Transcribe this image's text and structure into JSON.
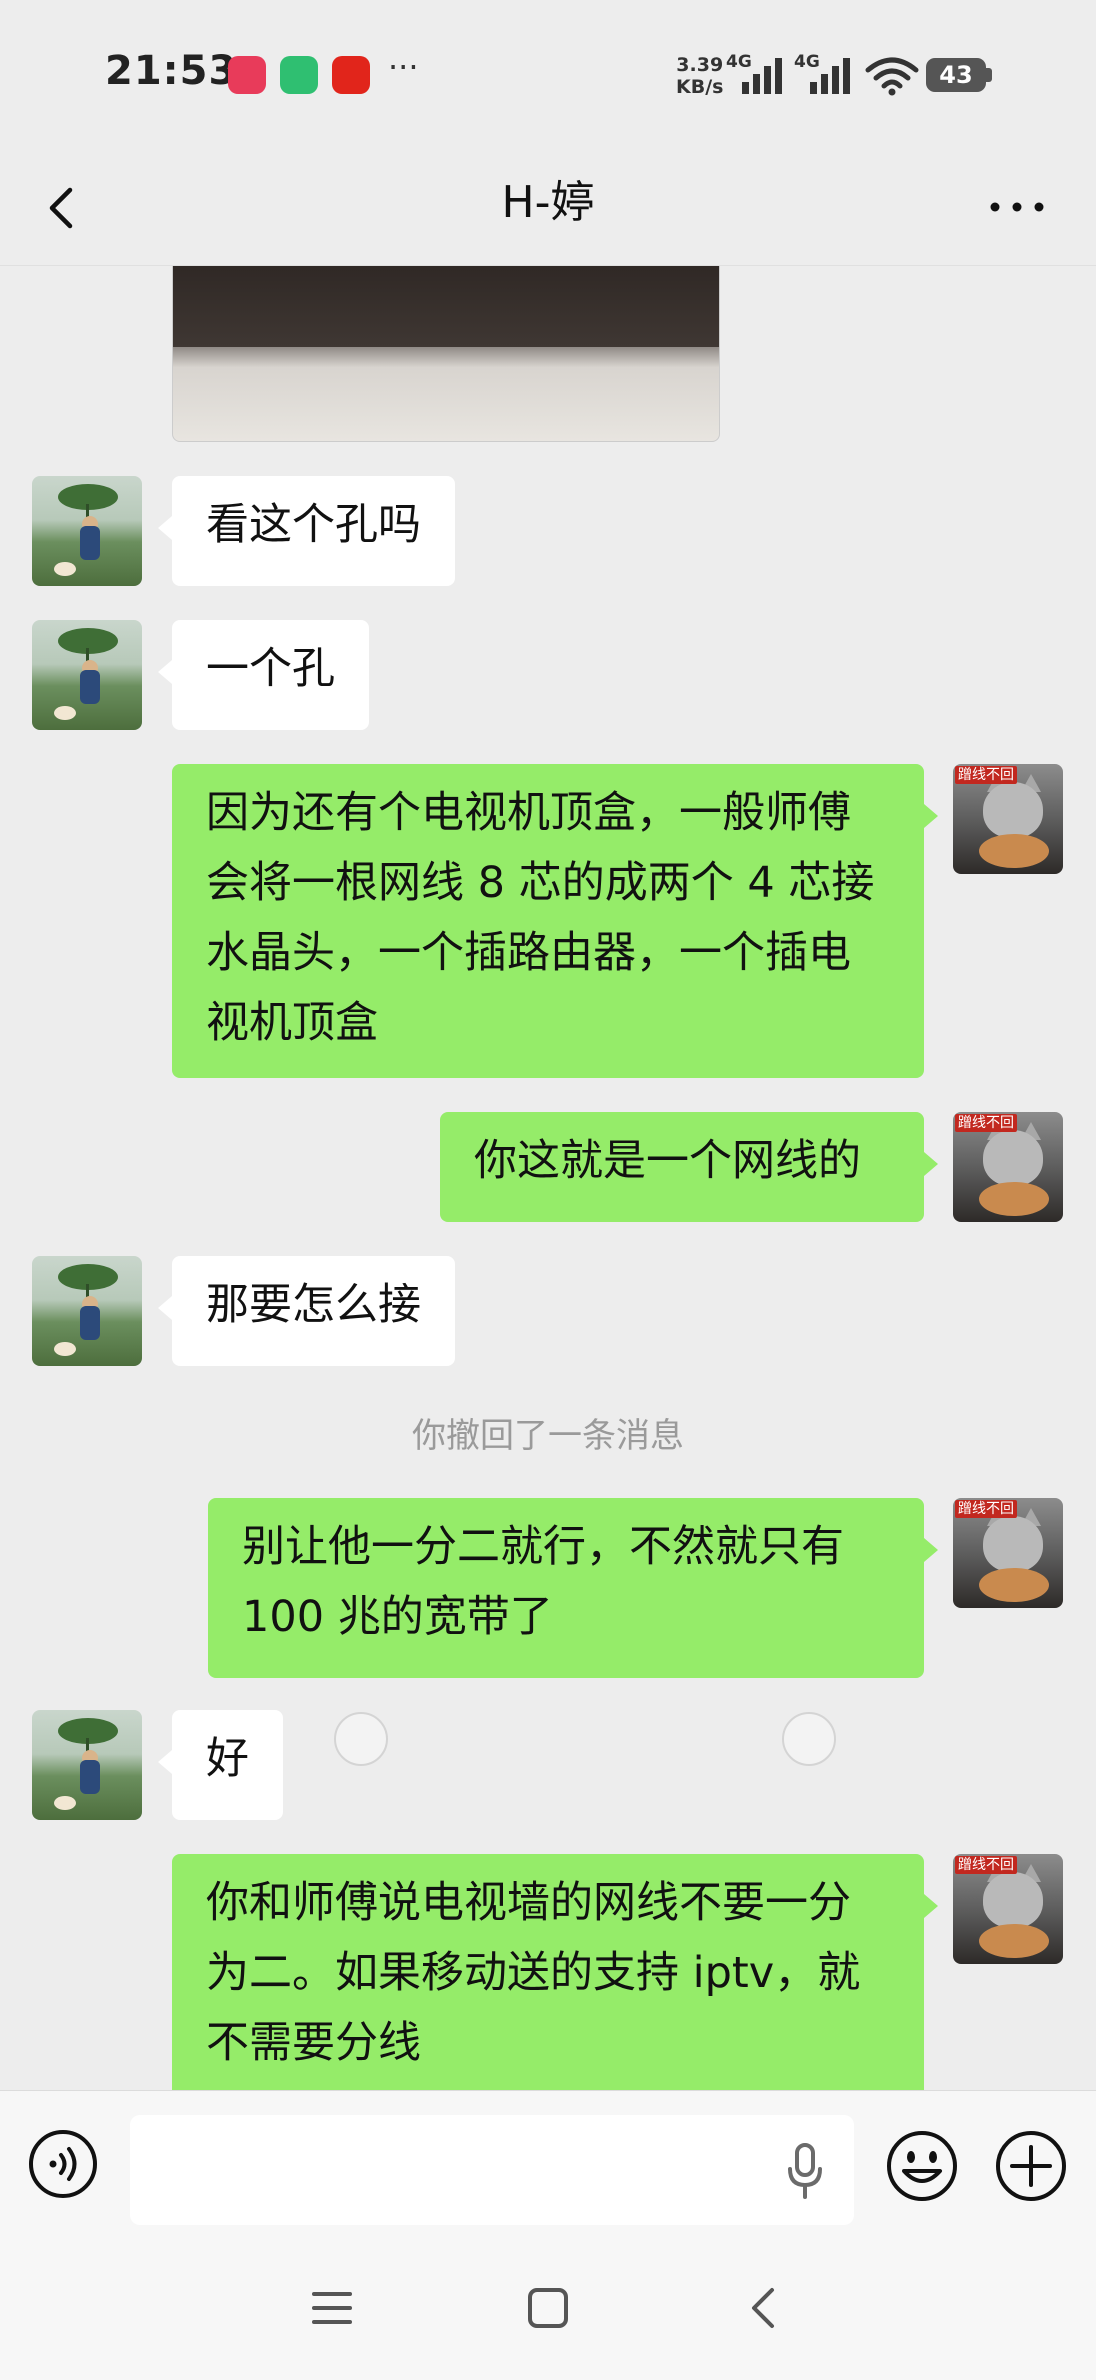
{
  "status_bar": {
    "time": "21:53",
    "apps": [
      {
        "icon": "shopping-618-app-icon",
        "color": "#e83b5a"
      },
      {
        "icon": "mijia-app-icon",
        "color": "#2fbf71"
      },
      {
        "icon": "tmall-app-icon",
        "color": "#e1251b"
      }
    ],
    "more": "···",
    "net_speed_value": "3.39",
    "net_speed_unit": "KB/s",
    "signal1_label": "4G",
    "signal2_label": "4G",
    "battery": "43"
  },
  "header": {
    "title": "H-婷"
  },
  "messages": [
    {
      "side": "in",
      "text": "看这个孔吗"
    },
    {
      "side": "in",
      "text": "一个孔"
    },
    {
      "side": "out",
      "text": "因为还有个电视机顶盒，一般师傅会将一根网线 8 芯的成两个 4 芯接水晶头，一个插路由器，一个插电视机顶盒"
    },
    {
      "side": "out",
      "text": "你这就是一个网线的"
    },
    {
      "side": "in",
      "text": "那要怎么接"
    },
    {
      "side": "system",
      "text": "你撤回了一条消息"
    },
    {
      "side": "out",
      "text": "别让他一分二就行，不然就只有100 兆的宽带了"
    },
    {
      "side": "in",
      "text": "好"
    },
    {
      "side": "out",
      "text": "你和师傅说电视墙的网线不要一分为二。如果移动送的支持 iptv，就不需要分线"
    }
  ],
  "avatar_right_tag": "蹭线不回",
  "input_bar": {
    "placeholder": ""
  },
  "colors": {
    "background": "#ededed",
    "bubble_out": "#95ec69",
    "bubble_in": "#ffffff"
  }
}
